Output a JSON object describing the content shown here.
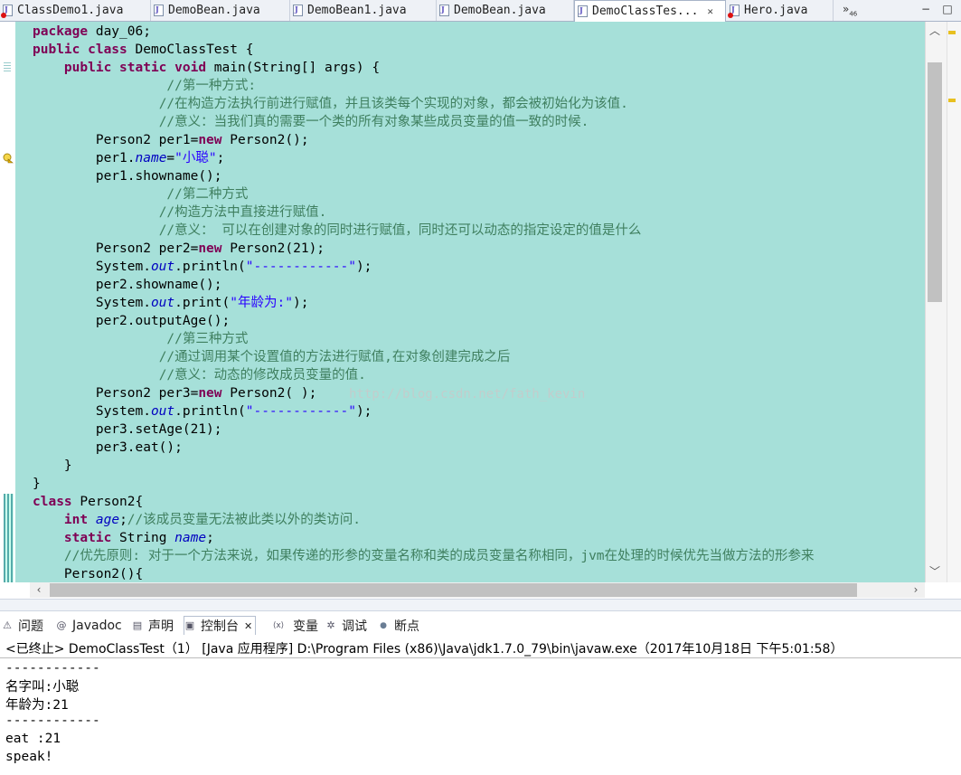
{
  "editor_tabs": [
    {
      "label": "ClassDemo1.java",
      "error": true
    },
    {
      "label": "DemoBean.java",
      "error": false
    },
    {
      "label": "DemoBean1.java",
      "error": false
    },
    {
      "label": "DemoBean.java",
      "error": false
    },
    {
      "label": "DemoClassTes...",
      "error": false,
      "active": true,
      "close": "✕"
    },
    {
      "label": "Hero.java",
      "error": true
    }
  ],
  "overflow": {
    "glyph": "»",
    "count": "46"
  },
  "window_buttons": {
    "minimize": "−",
    "maximize": "□"
  },
  "code_lines": [
    [
      [
        "kw",
        "package"
      ],
      [
        "",
        "day_06;"
      ]
    ],
    [
      [
        "kw",
        "public class"
      ],
      [
        "",
        "DemoClassTest {"
      ]
    ],
    [
      [
        "",
        "    "
      ],
      [
        "kw",
        "public static void"
      ],
      [
        "",
        "main(String[] args) {"
      ]
    ],
    [
      [
        "",
        "                 "
      ],
      [
        "cm",
        "//第一种方式:"
      ]
    ],
    [
      [
        "",
        "                "
      ],
      [
        "cm",
        "//在构造方法执行前进行赋值，并且该类每个实现的对象，都会被初始化为该值."
      ]
    ],
    [
      [
        "",
        "                "
      ],
      [
        "cm",
        "//意义：当我们真的需要一个类的所有对象某些成员变量的值一致的时候."
      ]
    ],
    [
      [
        "",
        "        Person2 per1="
      ],
      [
        "kw",
        "new"
      ],
      [
        "",
        "Person2();"
      ]
    ],
    [
      [
        "",
        "        per1."
      ],
      [
        "fld",
        "name"
      ],
      [
        "",
        "="
      ],
      [
        "st",
        "\"小聪\""
      ],
      [
        "",
        ";"
      ]
    ],
    [
      [
        "",
        "        per1.showname();"
      ]
    ],
    [
      [
        "",
        "                 "
      ],
      [
        "cm",
        "//第二种方式"
      ]
    ],
    [
      [
        "",
        "                "
      ],
      [
        "cm",
        "//构造方法中直接进行赋值."
      ]
    ],
    [
      [
        "",
        "                "
      ],
      [
        "cm",
        "//意义： 可以在创建对象的同时进行赋值，同时还可以动态的指定设定的值是什么"
      ]
    ],
    [
      [
        "",
        "        Person2 per2="
      ],
      [
        "kw",
        "new"
      ],
      [
        "",
        "Person2(21);"
      ]
    ],
    [
      [
        "",
        "        System."
      ],
      [
        "fld",
        "out"
      ],
      [
        "",
        ".println("
      ],
      [
        "st",
        "\"------------\""
      ],
      [
        "",
        ");"
      ]
    ],
    [
      [
        "",
        "        per2.showname();"
      ]
    ],
    [
      [
        "",
        "        System."
      ],
      [
        "fld",
        "out"
      ],
      [
        "",
        ".print("
      ],
      [
        "st",
        "\"年龄为:\""
      ],
      [
        "",
        ");"
      ]
    ],
    [
      [
        "",
        "        per2.outputAge();"
      ]
    ],
    [
      [
        "",
        "                 "
      ],
      [
        "cm",
        "//第三种方式"
      ]
    ],
    [
      [
        "",
        "                "
      ],
      [
        "cm",
        "//通过调用某个设置值的方法进行赋值,在对象创建完成之后"
      ]
    ],
    [
      [
        "",
        "                "
      ],
      [
        "cm",
        "//意义：动态的修改成员变量的值."
      ]
    ],
    [
      [
        "",
        "        Person2 per3="
      ],
      [
        "kw",
        "new"
      ],
      [
        "",
        "Person2( );"
      ]
    ],
    [
      [
        "",
        "        System."
      ],
      [
        "fld",
        "out"
      ],
      [
        "",
        ".println("
      ],
      [
        "st",
        "\"------------\""
      ],
      [
        "",
        ");"
      ]
    ],
    [
      [
        "",
        "        per3.setAge(21);"
      ]
    ],
    [
      [
        "",
        "        per3.eat();"
      ]
    ],
    [
      [
        "",
        "    }"
      ]
    ],
    [
      [
        "",
        "}"
      ]
    ],
    [
      [
        "kw",
        "class"
      ],
      [
        "",
        "Person2{"
      ]
    ],
    [
      [
        "",
        "    "
      ],
      [
        "kw",
        "int"
      ],
      [
        "fld",
        "age"
      ],
      [
        "",
        ";"
      ],
      [
        "cm",
        "//该成员变量无法被此类以外的类访问."
      ]
    ],
    [
      [
        "",
        "    "
      ],
      [
        "kw",
        "static"
      ],
      [
        "",
        "String "
      ],
      [
        "fld",
        "name"
      ],
      [
        "",
        ";"
      ]
    ],
    [
      [
        "",
        "    "
      ],
      [
        "cm",
        "//优先原则: 对于一个方法来说，如果传递的形参的变量名称和类的成员变量名称相同，jvm在处理的时候优先当做方法的形参来"
      ]
    ],
    [
      [
        "",
        "    Person2(){"
      ]
    ]
  ],
  "watermark": "http://blog.csdn.net/fath_kevin",
  "view_tabs": [
    {
      "label": "问题",
      "icon": "problems-icon",
      "glyph": "⚠"
    },
    {
      "label": "Javadoc",
      "icon": "at-icon",
      "glyph": "@"
    },
    {
      "label": "声明",
      "icon": "declaration-icon",
      "glyph": "▤"
    },
    {
      "label": "控制台",
      "icon": "console-icon",
      "glyph": "▣",
      "active": true,
      "close": "✕"
    },
    {
      "label": "变量",
      "icon": "variables-icon",
      "glyph": "⟨x⟩"
    },
    {
      "label": "调试",
      "icon": "debug-icon",
      "glyph": "✲"
    },
    {
      "label": "断点",
      "icon": "breakpoints-icon",
      "glyph": "●"
    }
  ],
  "console": {
    "header": "<已终止> DemoClassTest（1） [Java 应用程序] D:\\Program Files (x86)\\Java\\jdk1.7.0_79\\bin\\javaw.exe（2017年10月18日 下午5:01:58）",
    "output": [
      "------------",
      "名字叫:小聪",
      "年龄为:21",
      "------------",
      "eat :21",
      "speak!"
    ]
  },
  "scroll": {
    "up": "︿",
    "down": "﹀",
    "left": "‹",
    "right": "›"
  }
}
